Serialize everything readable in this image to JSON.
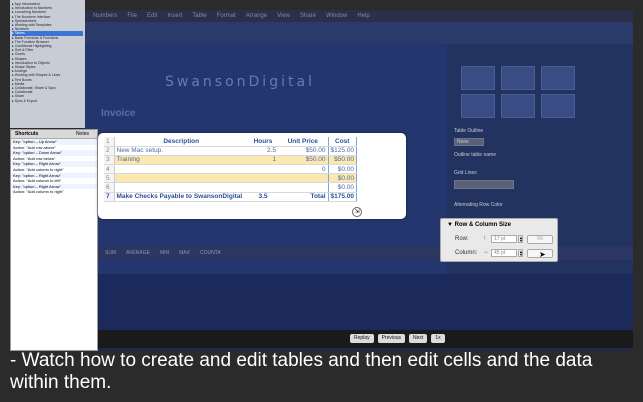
{
  "background_app": {
    "menubar": [
      "Numbers",
      "File",
      "Edit",
      "Insert",
      "Table",
      "Format",
      "Arrange",
      "View",
      "Share",
      "Window",
      "Help"
    ],
    "logo": "SwansonDigital",
    "invoice_title": "Invoice",
    "statusbar": [
      "SUM",
      "AVERAGE",
      "MIN",
      "MAX",
      "COUNTA"
    ]
  },
  "doc_outline": {
    "items": [
      "App Introduction",
      "Introduction to Numbers",
      "Launching Numbers",
      "The Numbers Interface",
      "Spreadsheets",
      "Working with Templates",
      "Numbers",
      "Tables",
      "Basic Formulas & Functions",
      "The Function Browser",
      "Conditional Highlighting",
      "Sort & Filter",
      "Charts",
      "Shapes",
      "Introduction to Objects",
      "Shape Styles",
      "Arrange",
      "Working with Shapes & Lines",
      "Text Boxes",
      "Media",
      "Collaborate, Share & Sync",
      "Collaborate",
      "Share",
      "Sync & Export"
    ],
    "selected_index": 7
  },
  "shortcuts": {
    "tab_label": "Shortcuts",
    "notes_label": "Notes",
    "lines": [
      "Key: \"option – Up Arrow\"",
      "Action: \"Add row above\"",
      "Key: \"option – Down Arrow\"",
      "Action: \"Add row below\"",
      "Key: \"option – Right Arrow\"",
      "Action: \"Add column to right\"",
      "Key: \"option – Right Arrow\"",
      "Action: \"Add column to left\"",
      "Key: \"option – Right Arrow\"",
      "Action: \"Add column to right\""
    ]
  },
  "table": {
    "headers": [
      "Description",
      "Hours",
      "Unit Price",
      "Cost"
    ],
    "rows": [
      {
        "n": "1",
        "desc": "",
        "hours": "",
        "price": "",
        "cost": ""
      },
      {
        "n": "2",
        "desc": "New Mac setup.",
        "hours": "2.5",
        "price": "$50.00",
        "cost": "$125.00"
      },
      {
        "n": "3",
        "desc": "Training",
        "hours": "1",
        "price": "$50.00",
        "cost": "$50.00"
      },
      {
        "n": "4",
        "desc": "",
        "hours": "",
        "price": "0",
        "cost": "$0.00"
      },
      {
        "n": "5",
        "desc": "",
        "hours": "",
        "price": "",
        "cost": "$0.00"
      },
      {
        "n": "6",
        "desc": "",
        "hours": "",
        "price": "",
        "cost": "$0.00"
      }
    ],
    "footer": {
      "n": "7",
      "desc": "Make Checks Payable to SwansonDigital",
      "hours": "3.5",
      "price": "Total",
      "cost": "$175.00"
    }
  },
  "inspector": {
    "table_outline_label": "Table Outline",
    "outline_value": "None",
    "outline_checkbox": "Outline table name",
    "grid_lines_label": "Grid Lines",
    "alternating_label": "Alternating Row Color"
  },
  "row_column_size": {
    "title": "Row & Column Size",
    "row_label": "Row:",
    "row_value": "17 pt",
    "column_label": "Column:",
    "column_value": "45 pt",
    "fit_label": "Fit"
  },
  "playback": {
    "replay": "Replay",
    "previous": "Previous",
    "next": "Next",
    "speed": "1x"
  },
  "caption": "- Watch how to create and edit tables and then edit cells and the data within them."
}
